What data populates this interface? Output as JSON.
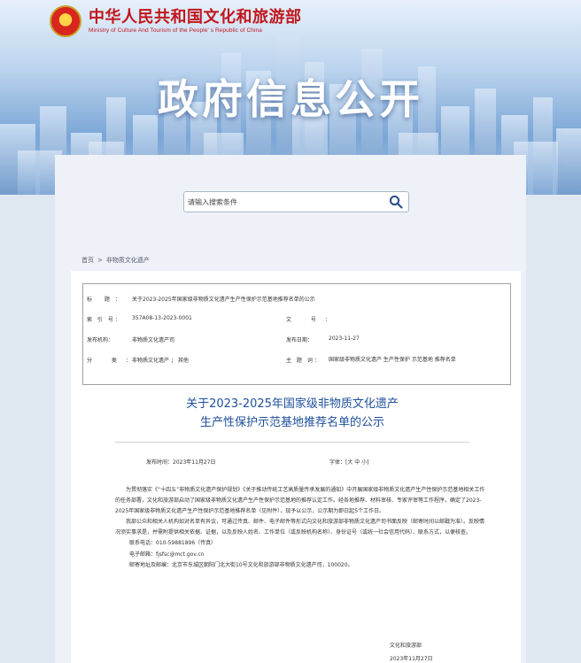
{
  "header": {
    "org_name_cn": "中华人民共和国文化和旅游部",
    "org_name_en": "Ministry of Culture And Tourism of the People' s Republic of China",
    "banner_title": "政府信息公开"
  },
  "search": {
    "placeholder": "请输入搜索条件",
    "icon": "search-icon"
  },
  "breadcrumb": {
    "home": "首页",
    "separator": ">",
    "current": "非物质文化遗产"
  },
  "meta": {
    "title_label": "标 题：",
    "title_value": "关于2023-2025年国家级非物质文化遗产生产性保护示范基地推荐名单的公示",
    "index_label": "索 引 号：",
    "index_value": "357A08-13-2023-0001",
    "docno_label": "文 号：",
    "docno_value": "",
    "org_label": "发布机构：",
    "org_value": "非物质文化遗产司",
    "date_label": "发布日期：",
    "date_value": "2023-11-27",
    "category_label": "分 类：",
    "category_value": "非物质文化遗产 ； 其他",
    "subject_label": "主 题 词：",
    "subject_value": "国家级非物质文化遗产 生产性保护 示范基地 推荐名单"
  },
  "article": {
    "title_line1": "关于2023-2025年国家级非物质文化遗产",
    "title_line2": "生产性保护示范基地推荐名单的公示",
    "pub_time": "发布时间：2023年11月27日",
    "font_size": "字体：[大 中 小]",
    "para1": "为贯彻落实《“十四五”非物质文化遗产保护规划》《关于推动传统工艺高质量传承发展的通知》中开展国家级非物质文化遗产生产性保护示范基地相关工作的任务部署，文化和旅游部启动了国家级非物质文化遗产生产性保护示范基地的推荐认定工作。经各地推荐、材料审核、专家评审等工作程序，确定了2023-2025年国家级非物质文化遗产生产性保护示范基地推荐名单（见附件），现予以公示，公示期为即日起5个工作日。",
    "para2": "我部公众和相关人机构如对名单有异议，可通过传真、邮件、电子邮件等形式向文化和旅游部非物质文化遗产司书面反映（邮寄时间以邮戳为准）。反映情况须实事求是，并需附提供相关依据、证据，以及反映人姓名、工作单位（或反映机构名称）、身份证号（或统一社会信用代码）、联系方式，以便核查。",
    "contact_phone": "联系电话：010-59881896（传真）",
    "contact_email": "电子邮箱：fjsfsc@mct.gov.cn",
    "contact_address": "邮寄地址及邮编：北京市东城区朝阳门北大街10号文化和旅游部非物质文化遗产司，100020。",
    "signature": "文化和旅游部",
    "sign_date": "2023年11月27日"
  }
}
